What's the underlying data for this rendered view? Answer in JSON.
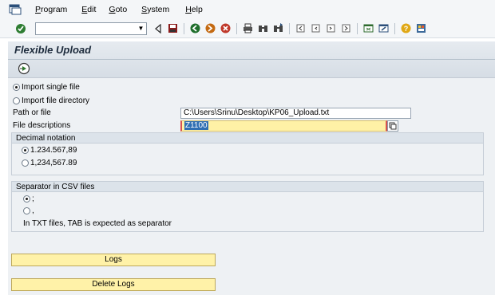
{
  "menu": {
    "items": [
      {
        "label": "Program"
      },
      {
        "label": "Edit"
      },
      {
        "label": "Goto"
      },
      {
        "label": "System"
      },
      {
        "label": "Help"
      }
    ]
  },
  "toolbar": {
    "command_field_value": "",
    "icons": [
      "enter-icon",
      "back-icon",
      "save-icon",
      "exit-icon",
      "cancel-icon",
      "print-icon",
      "find-icon",
      "find-next-icon",
      "first-page-icon",
      "prev-page-icon",
      "next-page-icon",
      "last-page-icon",
      "new-session-icon",
      "shortcut-icon",
      "help-icon",
      "layout-icon"
    ]
  },
  "screen": {
    "title": "Flexible Upload"
  },
  "form": {
    "import_single_label": "Import single file",
    "import_dir_label": "Import file directory",
    "import_selected": "single",
    "path_label": "Path or file",
    "path_value": "C:\\Users\\Srinu\\Desktop\\KP06_Upload.txt",
    "file_desc_label": "File descriptions",
    "file_desc_value": "Z1100"
  },
  "decimal": {
    "heading": "Decimal notation",
    "option1": "1.234.567,89",
    "option2": "1,234,567.89",
    "selected": "option1"
  },
  "separator": {
    "heading": "Separator in CSV files",
    "option1": ";",
    "option2": ",",
    "selected": "option1",
    "note": "In TXT files, TAB is expected as separator"
  },
  "buttons": {
    "logs": "Logs",
    "delete_logs": "Delete Logs"
  },
  "colors": {
    "button_yellow": "#fff2a8",
    "field_yellow": "#fff1a6",
    "panel_bg": "#eef1f4"
  }
}
